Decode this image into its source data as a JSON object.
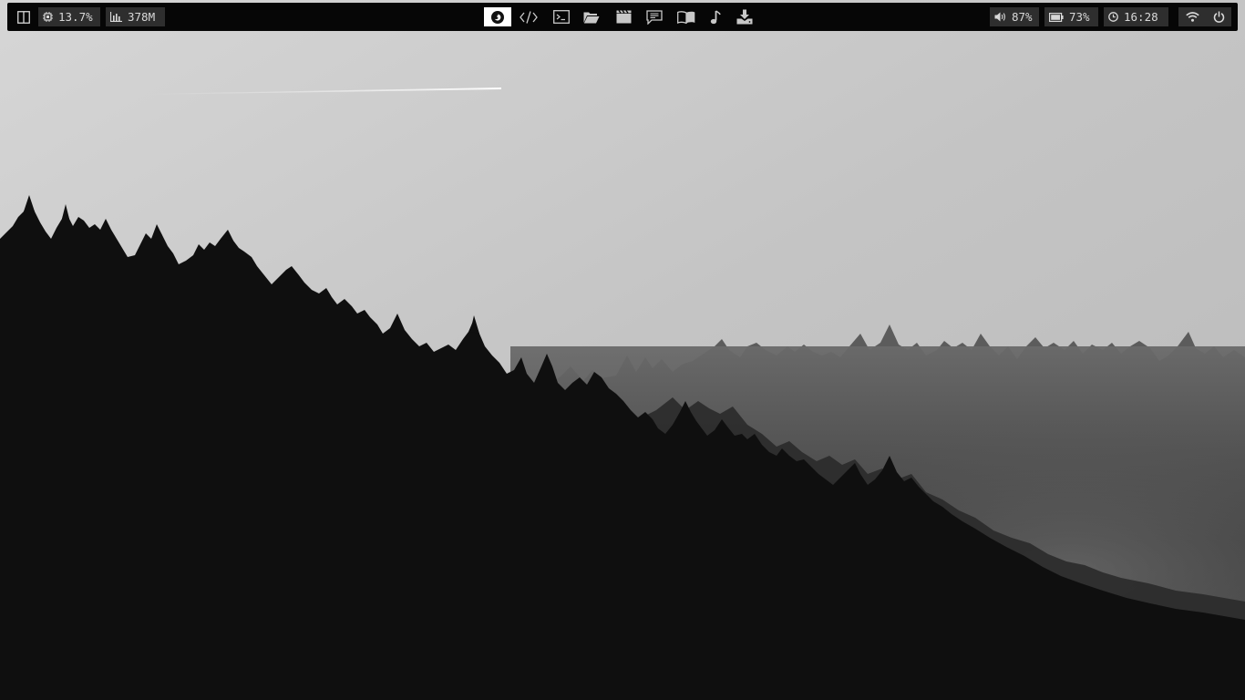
{
  "topbar": {
    "left": {
      "layout_icon": "split-layout-icon",
      "cpu": {
        "icon": "cpu-chip-icon",
        "value": "13.7%"
      },
      "memory": {
        "icon": "bar-chart-icon",
        "value": "378M"
      }
    },
    "workspaces": [
      {
        "icon": "browser-icon",
        "active": true
      },
      {
        "icon": "code-icon",
        "active": false
      },
      {
        "icon": "terminal-icon",
        "active": false
      },
      {
        "icon": "folder-icon",
        "active": false
      },
      {
        "icon": "film-icon",
        "active": false
      },
      {
        "icon": "chat-icon",
        "active": false
      },
      {
        "icon": "book-icon",
        "active": false
      },
      {
        "icon": "music-note-icon",
        "active": false
      },
      {
        "icon": "download-icon",
        "active": false
      }
    ],
    "right": {
      "volume": {
        "icon": "speaker-icon",
        "value": "87%"
      },
      "battery": {
        "icon": "battery-icon",
        "value": "73%"
      },
      "clock": {
        "icon": "clock-icon",
        "value": "16:28"
      },
      "wifi_icon": "wifi-icon",
      "power_icon": "power-icon"
    }
  },
  "colors": {
    "bar_background": "#060606",
    "module_background": "#2e2e2e",
    "module_text": "#d8d8d8",
    "active_workspace": "#ffffff"
  },
  "wallpaper": "black-and-white misty pine forest under a pale sky with a contrail"
}
